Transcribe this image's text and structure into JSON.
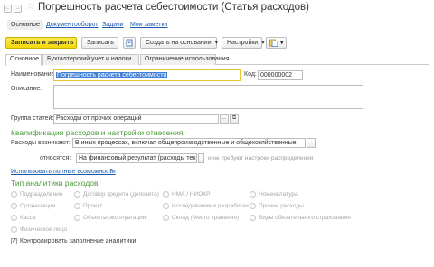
{
  "window": {
    "title": "Погрешность расчета себестоимости (Статья расходов)",
    "back_glyph": "←",
    "forward_glyph": "→",
    "star_glyph": "☆"
  },
  "nav_tabs": [
    "Основное",
    "Документооборот",
    "Задачи",
    "Мои заметки"
  ],
  "toolbar": {
    "save_close": "Записать и закрыть",
    "save": "Записать",
    "create_based": "Создать на основании",
    "settings": "Настройки",
    "dropdown_glyph": "▾"
  },
  "form_tabs": [
    "Основное",
    "Бухгалтерский учет и налоги",
    "Ограничение использования"
  ],
  "fields": {
    "name_label": "Наименование:",
    "name_value": "Погрешность расчета себестоимости",
    "code_label": "Код:",
    "code_value": "000000002",
    "description_label": "Описание:",
    "description_value": "",
    "group_label": "Группа статей:",
    "group_value": "Расходы от прочих операций",
    "ellipsis": "...",
    "open_glyph": "⧉"
  },
  "qualification": {
    "heading": "Квалификация расходов и настройки отнесения",
    "arise_label": "Расходы возникают:",
    "arise_value": "В иных процессах, включая общепроизводственные и общехозяйственные",
    "attributed_label": "относятся:",
    "attributed_value": "На финансовый результат (расходы тек. перио,",
    "attributed_hint": "и не требуют настроек распределения",
    "more_link": "Использовать полные возможности",
    "help_glyph": "?"
  },
  "analytics": {
    "heading": "Тип аналитики расходов",
    "options": [
      [
        "Подразделение",
        "Договор кредита (депозита)",
        "НМА / НИОКР",
        "Номенклатура"
      ],
      [
        "Организация",
        "Проект",
        "Исследования и разработки",
        "Прочие расходы"
      ],
      [
        "Касса",
        "Объекты эксплуатации",
        "Склад (Место хранения)",
        "Виды обязательного страхования"
      ],
      [
        "Физическое лицо"
      ]
    ],
    "control_label": "Контролировать заполнение аналитики",
    "control_checked": "✓"
  }
}
